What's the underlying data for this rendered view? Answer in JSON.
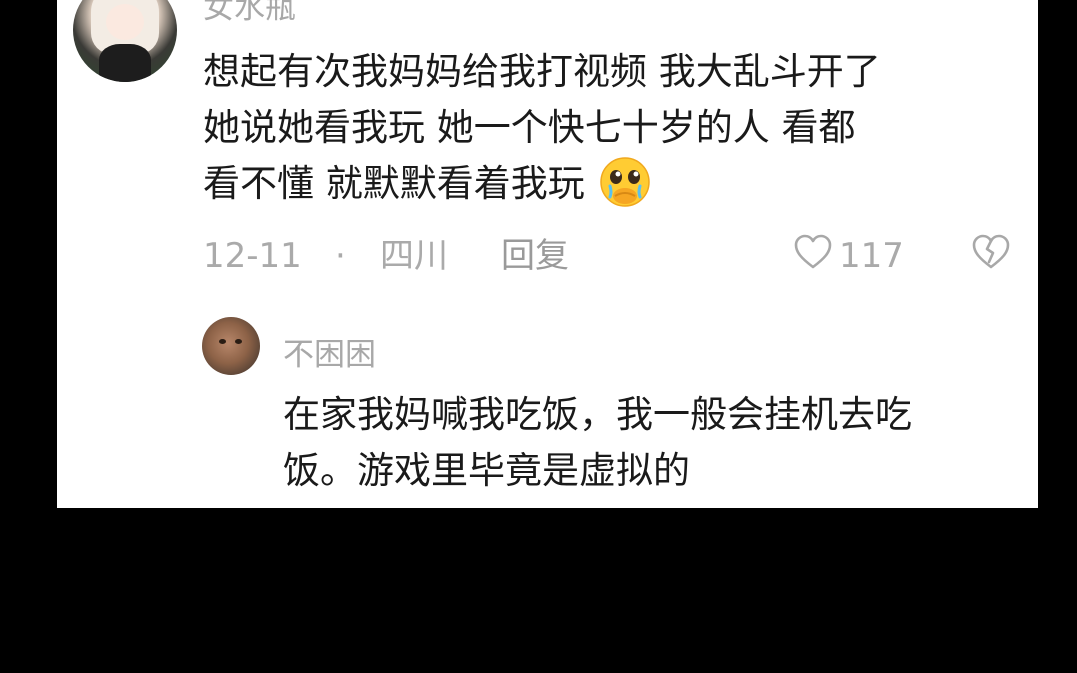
{
  "comment": {
    "username": "女水瓶",
    "lines": [
      "想起有次我妈妈给我打视频  我大乱斗开了",
      "她说她看我玩  她一个快七十岁的人  看都",
      "看不懂  就默默看着我玩"
    ],
    "emoji": "pleading-face-emoji",
    "date": "12-11",
    "separator": "·",
    "location": "四川",
    "reply_label": "回复",
    "like_count": "117"
  },
  "reply": {
    "username": "不困困",
    "lines": [
      "在家我妈喊我吃饭，我一般会挂机去吃",
      "饭。游戏里毕竟是虚拟的"
    ]
  },
  "colors": {
    "background": "#000000",
    "card": "#ffffff",
    "text": "#1a1a1a",
    "meta": "#aaaaaa"
  }
}
